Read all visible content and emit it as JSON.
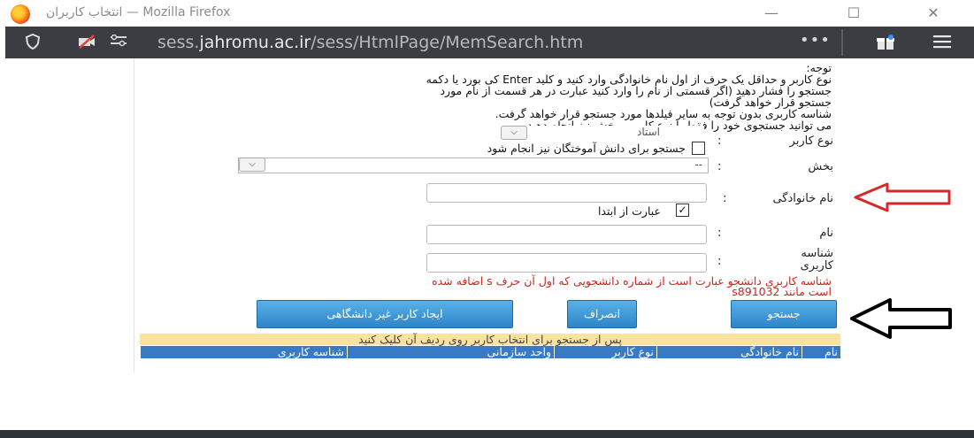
{
  "window": {
    "title": "انتخاب کاربران — Mozilla Firefox",
    "min": "—",
    "max": "☐",
    "close": "✕"
  },
  "urlbar": {
    "url_prefix": "sess.",
    "url_domain": "jahromu.ac.ir",
    "url_path": "/sess/HtmlPage/MemSearch.htm",
    "more": "•••"
  },
  "notice": {
    "title": "توجه:",
    "lines": [
      "نوع کاربر و حداقل یک حرف از اول نام خانوادگی وارد کنید و کلید Enter کی بورد یا دکمه",
      "جستجو را فشار دهید (اگر قسمتی از نام را وارد کنید عبارت در هر قسمت از نام مورد",
      "جستجو قرار خواهد گرفت)",
      "شناسه کاربری بدون توجه به سایر فیلدها مورد جستجو قرار خواهد گرفت.",
      "می توانید جستجوی خود را فقط با نوع کاربر و بخش نیز انجام دهید."
    ]
  },
  "form": {
    "colon": ":",
    "user_type_label": "نوع کاربر",
    "user_type_value": "استاد",
    "student_search_label": "جستجو برای دانش آموختگان نیز انجام شود",
    "dept_label": "بخش",
    "dept_value": "--",
    "lastname_label": "نام خانوادگی",
    "from_start_label": "عبارت از ابتدا",
    "from_start_checked": "✓",
    "firstname_label": "نام",
    "userid_label_1": "شناسه",
    "userid_label_2": "کاربری",
    "error_line_1": "شناسه کاربری دانشجو عبارت است از شماره دانشجویی که اول آن حرف s اضافه شده",
    "error_line_2": "است مانند s891032"
  },
  "buttons": {
    "search": "جستجو",
    "cancel": "انصراف",
    "create_user": "ایجاد کاربر غیر دانشگاهی"
  },
  "results": {
    "hint": "پس از جستجو برای انتخاب کاربر روی ردیف آن کلیک کنید",
    "columns": [
      "نام",
      "نام خانوادگی",
      "نوع کاربر",
      "واحد سازمانی",
      "شناسه کاربری"
    ]
  },
  "colors": {
    "accent_button": "#3a8fd6",
    "header_blue": "#3a79c3",
    "hint_yellow": "#fbe29e",
    "error_red": "#d62020",
    "red_arrow": "#d32a2a"
  }
}
